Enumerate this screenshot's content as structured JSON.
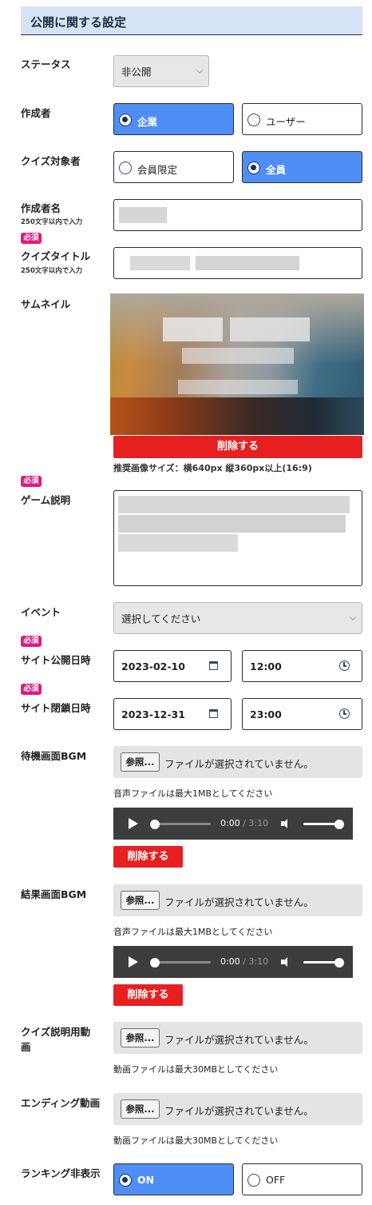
{
  "header": {
    "title": "公開に関する設定"
  },
  "status": {
    "label": "ステータス",
    "value": "非公開"
  },
  "creator": {
    "label": "作成者",
    "options": [
      "企業",
      "ユーザー"
    ],
    "selected": "企業"
  },
  "audience": {
    "label": "クイズ対象者",
    "options": [
      "会員限定",
      "全員"
    ],
    "selected": "全員"
  },
  "creator_name": {
    "label": "作成者名",
    "hint": "250文字以内で入力"
  },
  "required_label": "必須",
  "quiz_title": {
    "label": "クイズタイトル",
    "hint": "250文字以内で入力"
  },
  "thumbnail": {
    "label": "サムネイル",
    "delete_label": "削除する",
    "note": "推奨画像サイズ：横640px 縦360px以上(16:9)"
  },
  "game_desc": {
    "label": "ゲーム説明"
  },
  "event": {
    "label": "イベント",
    "value": "選択してください"
  },
  "open_date": {
    "label": "サイト公開日時",
    "date": "2023-02-10",
    "time": "12:00"
  },
  "close_date": {
    "label": "サイト閉鎖日時",
    "date": "2023-12-31",
    "time": "23:00"
  },
  "wait_bgm": {
    "label": "待機画面BGM",
    "browse": "参照...",
    "file_status": "ファイルが選択されていません。",
    "note": "音声ファイルは最大1MBとしてください",
    "time": "0:00",
    "duration": "/ 3:10",
    "progress": 0,
    "volume": 1,
    "delete_label": "削除する"
  },
  "result_bgm": {
    "label": "結果画面BGM",
    "browse": "参照...",
    "file_status": "ファイルが選択されていません。",
    "note": "音声ファイルは最大1MBとしてください",
    "time": "0:00",
    "duration": "/ 3:10",
    "progress": 0,
    "volume": 1,
    "delete_label": "削除する"
  },
  "quiz_video": {
    "label_line1": "クイズ説明用動",
    "label_line2": "画",
    "browse": "参照...",
    "file_status": "ファイルが選択されていません。",
    "note": "動画ファイルは最大30MBとしてください"
  },
  "ending_video": {
    "label": "エンディング動画",
    "browse": "参照...",
    "file_status": "ファイルが選択されていません。",
    "note": "動画ファイルは最大30MBとしてください"
  },
  "ranking_hide": {
    "label": "ランキング非表示",
    "options": [
      "ON",
      "OFF"
    ],
    "selected": "ON"
  }
}
